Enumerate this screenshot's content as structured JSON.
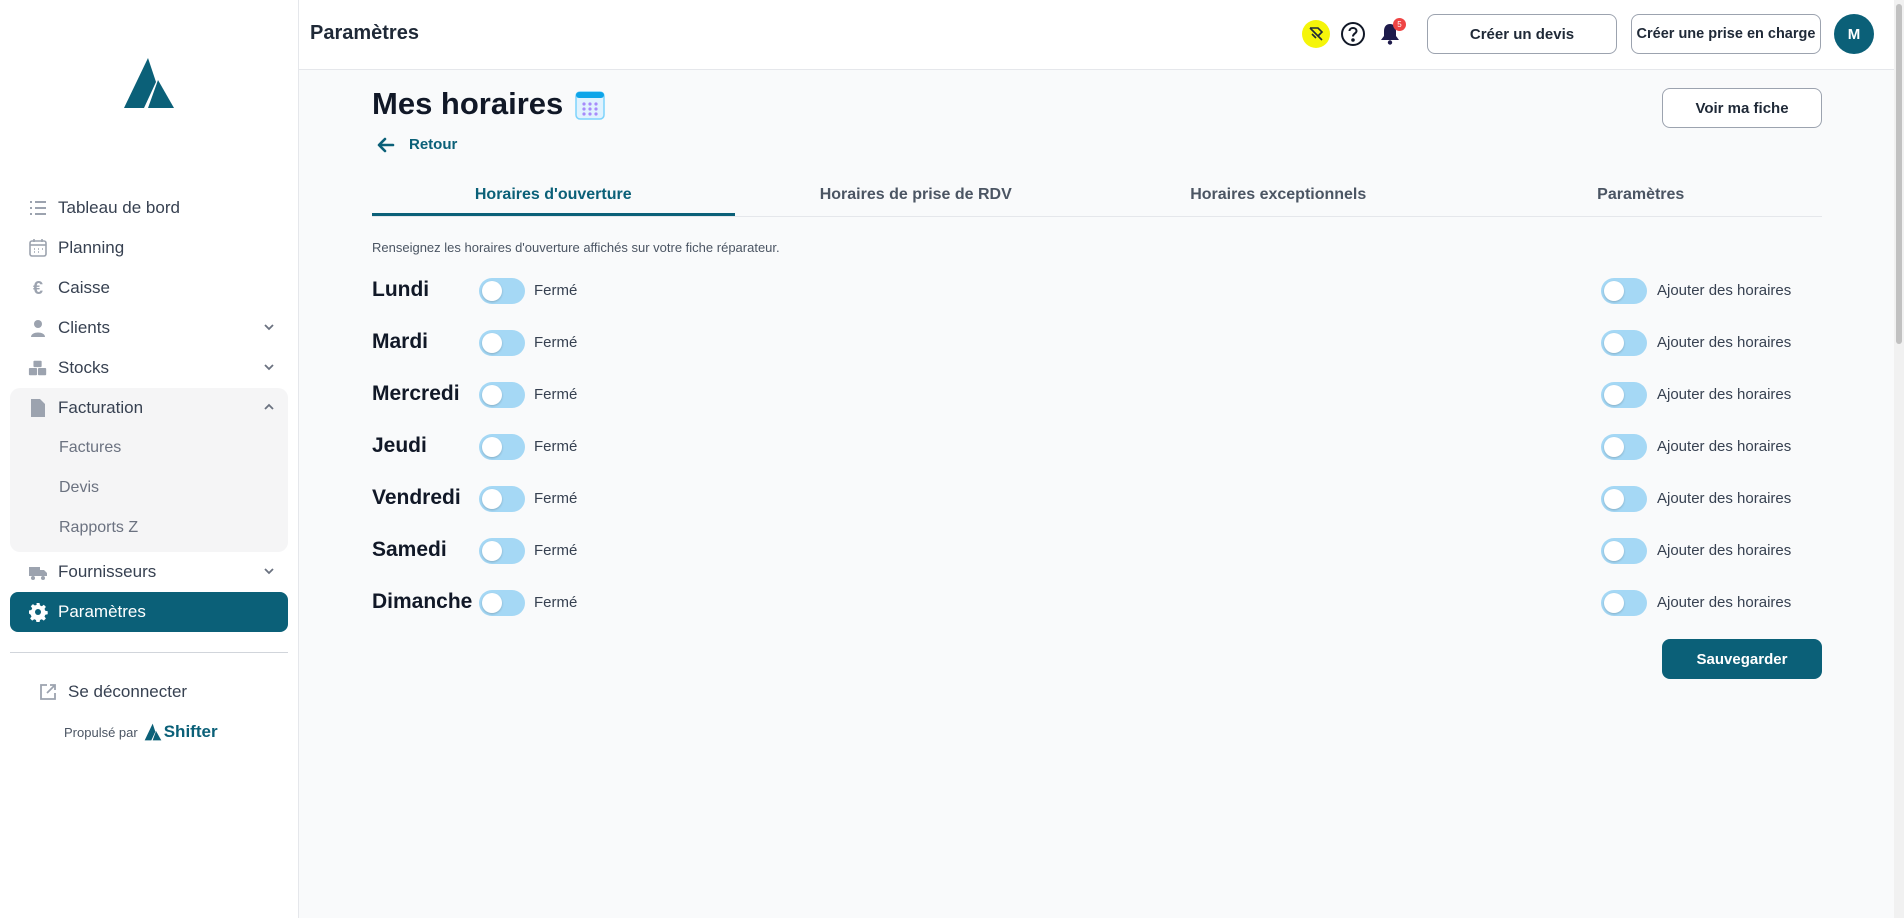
{
  "header": {
    "title": "Paramètres",
    "notification_count": "5",
    "create_quote_label": "Créer un devis",
    "create_intake_label": "Créer une prise en charge",
    "avatar_initial": "M"
  },
  "sidebar": {
    "items": [
      {
        "label": "Tableau de bord",
        "icon": "list-icon"
      },
      {
        "label": "Planning",
        "icon": "calendar-icon"
      },
      {
        "label": "Caisse",
        "icon": "euro-icon"
      },
      {
        "label": "Clients",
        "icon": "user-icon"
      },
      {
        "label": "Stocks",
        "icon": "boxes-icon"
      },
      {
        "label": "Facturation",
        "icon": "document-icon"
      }
    ],
    "billing_sub": [
      "Factures",
      "Devis",
      "Rapports Z"
    ],
    "suppliers_label": "Fournisseurs",
    "settings_label": "Paramètres",
    "logout_label": "Se déconnecter",
    "powered_by": "Propulsé par",
    "brand": "Shifter"
  },
  "main": {
    "title": "Mes horaires",
    "back_label": "Retour",
    "view_profile_label": "Voir ma fiche",
    "tabs": [
      {
        "label": "Horaires d'ouverture",
        "active": true
      },
      {
        "label": "Horaires de prise de RDV",
        "active": false
      },
      {
        "label": "Horaires exceptionnels",
        "active": false
      },
      {
        "label": "Paramètres",
        "active": false
      }
    ],
    "hint": "Renseignez les horaires d'ouverture affichés sur votre fiche réparateur.",
    "closed_label": "Fermé",
    "add_hours_label": "Ajouter des horaires",
    "days": [
      "Lundi",
      "Mardi",
      "Mercredi",
      "Jeudi",
      "Vendredi",
      "Samedi",
      "Dimanche"
    ],
    "save_label": "Sauvegarder"
  },
  "colors": {
    "accent": "#0b6078",
    "toggle_off": "#a5d8f5",
    "badge": "#ef4444",
    "highlight_icon_bg": "#f5f50a"
  }
}
